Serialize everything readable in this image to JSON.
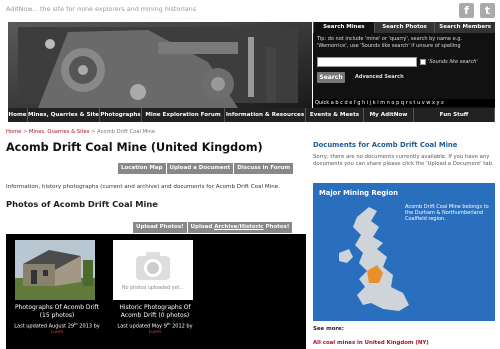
{
  "header": {
    "tagline": "AditNow... the site for mine explorers and mining historians",
    "social": [
      {
        "name": "facebook-icon",
        "glyph": "f"
      },
      {
        "name": "twitter-icon",
        "glyph": "t"
      }
    ]
  },
  "search": {
    "tabs": [
      "Search Mines",
      "Search Photos",
      "Search Members"
    ],
    "tip": "Tip: do not include 'mine' or 'quarry', search by name e.g. 'Wemorrice', use 'Sounds like search' if unsure of spelling",
    "sounds_like_label": "'Sounds like search'",
    "button_label": "Search",
    "advanced_label": "Advanced Search"
  },
  "alphabet": "Quick a b c d e f g h i j k l m n o p q r s t u v w x y z",
  "nav": {
    "items": [
      {
        "label": "Home"
      },
      {
        "label": "Mines, Quarries & Sites"
      },
      {
        "label": "Photographs"
      },
      {
        "label": "Mine Exploration Forum"
      },
      {
        "label": "Information & Resources"
      },
      {
        "label": "Events & Meets"
      },
      {
        "label": "My AditNow"
      },
      {
        "label": "Fun Stuff"
      }
    ]
  },
  "breadcrumb": {
    "home": "Home",
    "sep1": " > ",
    "section": "Mines, Quarries & Sites",
    "sep2": " > ",
    "current": "Acomb Drift Coal Mine"
  },
  "page": {
    "title": "Acomb Drift Coal Mine (United Kingdom)",
    "buttons": [
      "Location Map",
      "Upload a Document",
      "Discuss in Forum"
    ],
    "intro": "Information, history photographs (current and archive) and documents for Acomb Drift Coal Mine.",
    "photos_heading": "Photos of Acomb Drift Coal Mine",
    "photo_buttons": {
      "upload": "Upload Photos!",
      "archive_prefix": "Upload ",
      "archive_link": "Archive/Historic",
      "archive_suffix": " Photos!"
    }
  },
  "gallery": [
    {
      "title": "Photographs Of Acomb Drift (15 photos)",
      "updated_prefix": "Last updated August 29",
      "updated_sup": "th",
      "updated_suffix": " 2013 by",
      "by": "Luem"
    },
    {
      "title": "Historic Photographs Of Acomb Drift (0 photos)",
      "updated_prefix": "Last updated May 9",
      "updated_sup": "th",
      "updated_suffix": " 2012 by",
      "by": "Luem",
      "empty_text": "No photos uploaded yet..."
    }
  ],
  "documents": {
    "heading": "Documents for Acomb Drift Coal Mine",
    "text": "Sorry, there are no documents currently available. If you have any documents you can share please click the 'Upload a Document' tab."
  },
  "region": {
    "title": "Major Mining Region",
    "note": "Acomb Drift Coal Mine belongs to the Durham & Northumberland Coalfield region."
  },
  "footer": {
    "see_more": "See more:",
    "all_link": "All coal mines in United Kingdom (NY)"
  },
  "colors": {
    "nav_bg": "#222222",
    "link_red": "#aa1122",
    "heading_blue": "#1e5a96",
    "map_bg": "#2a6fbe",
    "region_highlight": "#e8912a"
  }
}
